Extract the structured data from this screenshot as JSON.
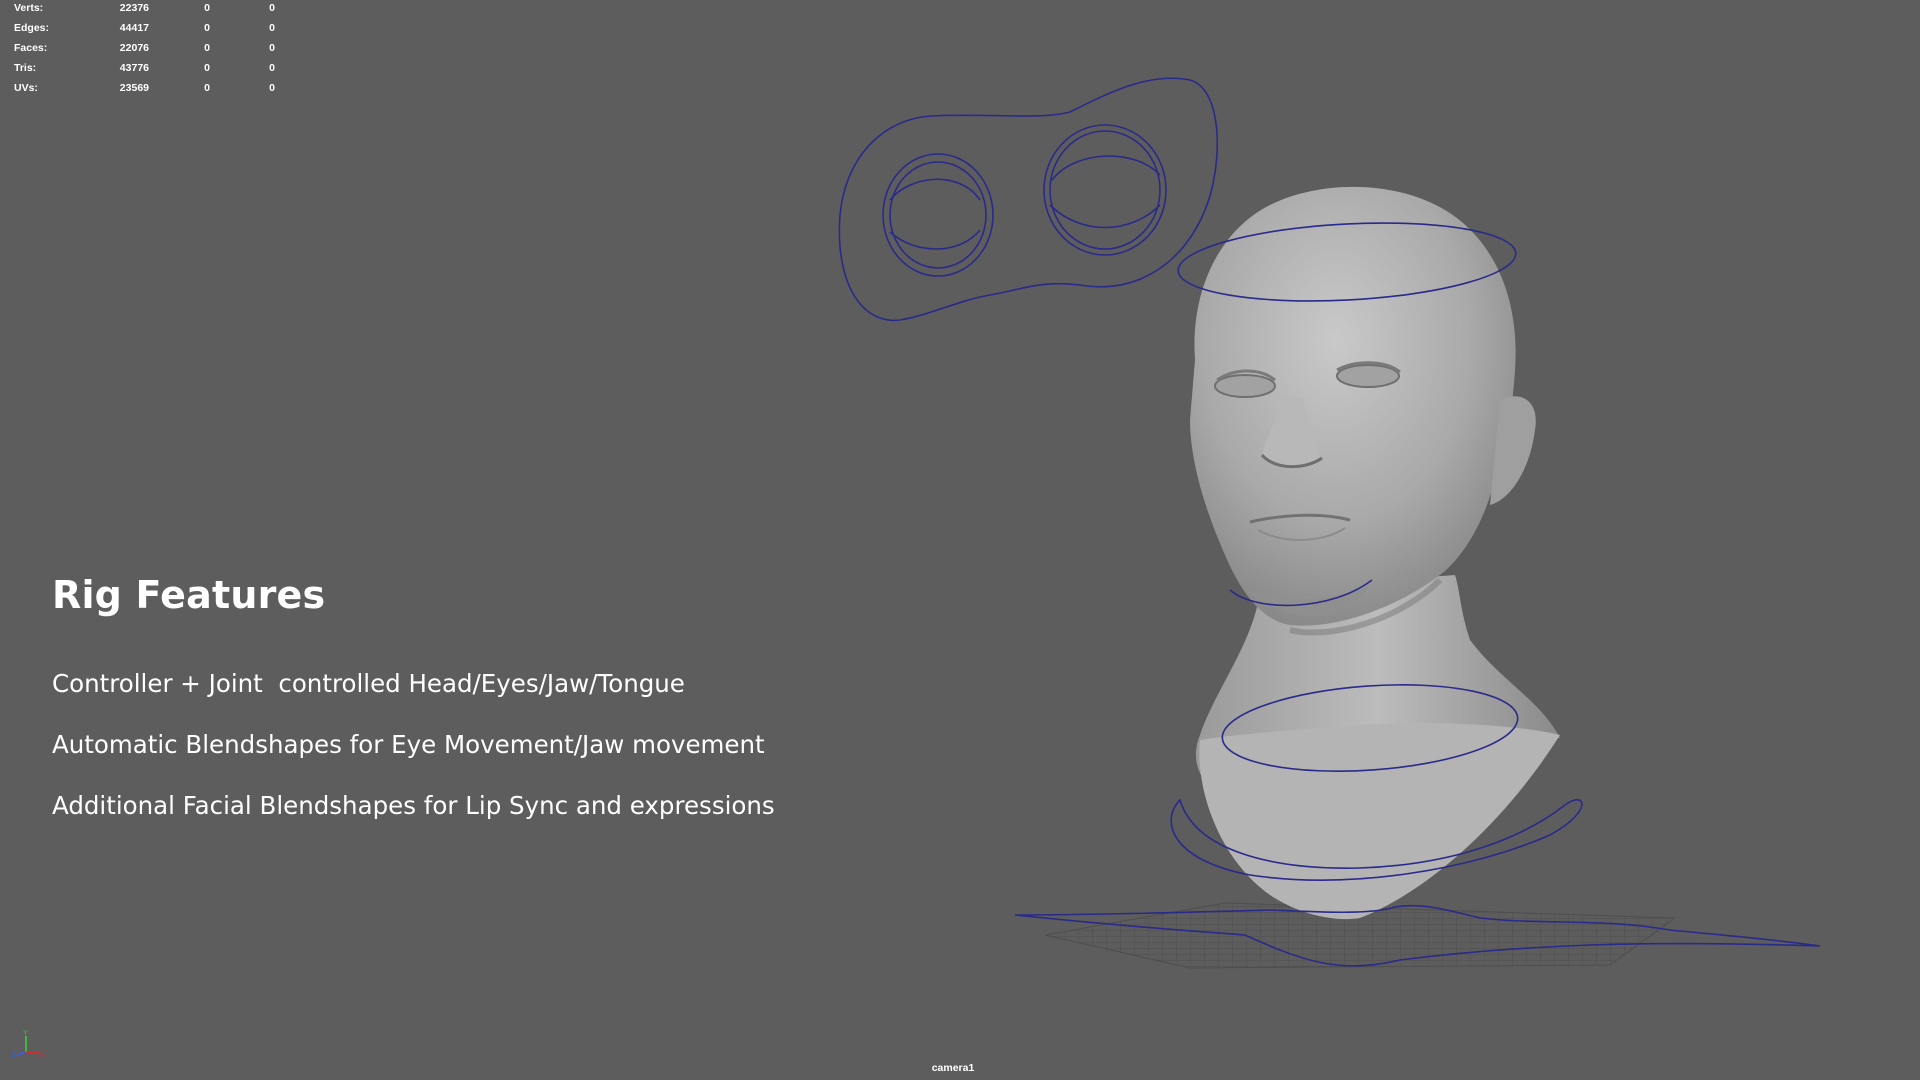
{
  "viewport": {
    "camera_name": "camera1",
    "background_color": "#5d5d5d",
    "controller_color": "#2a2a8a"
  },
  "hud": {
    "rows": [
      {
        "label": "Verts:",
        "values": [
          "22376",
          "0",
          "0"
        ]
      },
      {
        "label": "Edges:",
        "values": [
          "44417",
          "0",
          "0"
        ]
      },
      {
        "label": "Faces:",
        "values": [
          "22076",
          "0",
          "0"
        ]
      },
      {
        "label": "Tris:",
        "values": [
          "43776",
          "0",
          "0"
        ]
      },
      {
        "label": "UVs:",
        "values": [
          "23569",
          "0",
          "0"
        ]
      }
    ]
  },
  "overlay": {
    "title": "Rig Features",
    "lines": [
      "Controller + Joint  controlled Head/Eyes/Jaw/Tongue",
      "Automatic Blendshapes for Eye Movement/Jaw movement",
      "Additional Facial Blendshapes for Lip Sync and expressions"
    ]
  },
  "axis_gizmo": {
    "labels": [
      "Y",
      "Z",
      "X"
    ]
  }
}
